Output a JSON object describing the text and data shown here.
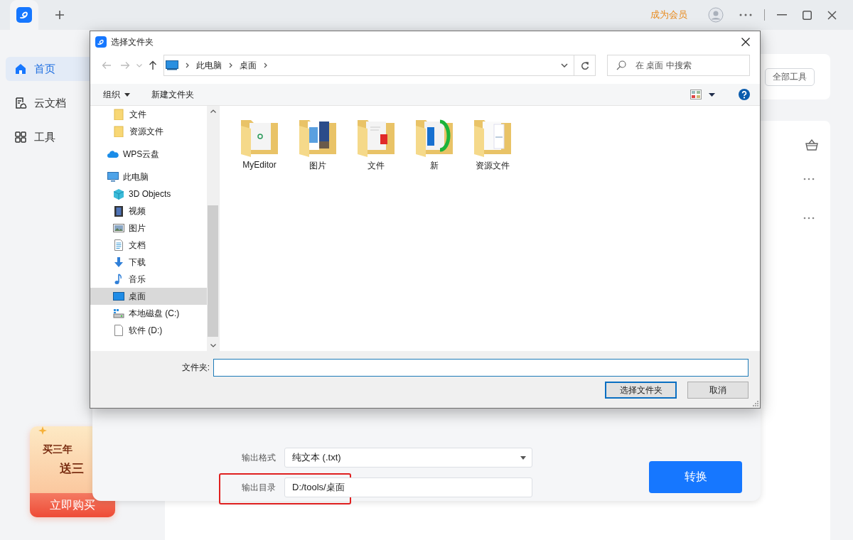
{
  "app": {
    "member_link": "成为会员",
    "sidebar": [
      {
        "label": "首页",
        "kind": "home",
        "selected": true
      },
      {
        "label": "云文档",
        "kind": "cloud-doc",
        "selected": false
      },
      {
        "label": "工具",
        "kind": "tools",
        "selected": false
      }
    ],
    "promo": {
      "line_1": "买三年",
      "line_2": "送三",
      "button": "立即购买"
    },
    "all_tools_button": "全部工具"
  },
  "convert_panel": {
    "rows": [
      {
        "label": "输出格式",
        "value": "纯文本 (.txt)",
        "kind": "select",
        "highlighted": false
      },
      {
        "label": "输出目录",
        "value": "D:/tools/桌面",
        "kind": "path",
        "highlighted": true
      }
    ],
    "convert_button": "转换"
  },
  "dialog": {
    "title": "选择文件夹",
    "breadcrumb": [
      "此电脑",
      "桌面"
    ],
    "search": {
      "placeholder": "在 桌面 中搜索"
    },
    "toolbar": [
      "组织",
      "新建文件夹"
    ],
    "nav": [
      {
        "label": "文件",
        "kind": "folder",
        "selected": false
      },
      {
        "label": "资源文件",
        "kind": "folder",
        "selected": false
      },
      {
        "label": "WPS云盘",
        "kind": "cloud",
        "selected": false
      },
      {
        "label": "此电脑",
        "kind": "pc",
        "selected": false,
        "children": [
          {
            "label": "3D Objects",
            "kind": "cube",
            "selected": false
          },
          {
            "label": "视频",
            "kind": "film",
            "selected": false
          },
          {
            "label": "图片",
            "kind": "picture",
            "selected": false
          },
          {
            "label": "文档",
            "kind": "document",
            "selected": false
          },
          {
            "label": "下载",
            "kind": "download",
            "selected": false
          },
          {
            "label": "音乐",
            "kind": "music",
            "selected": false
          },
          {
            "label": "桌面",
            "kind": "desktop",
            "selected": true
          },
          {
            "label": "本地磁盘 (C:)",
            "kind": "drive",
            "selected": false
          },
          {
            "label": "软件 (D:)",
            "kind": "disk",
            "selected": false
          }
        ]
      }
    ],
    "files": [
      {
        "name": "MyEditor",
        "kind": "app"
      },
      {
        "name": "图片",
        "kind": "pictures"
      },
      {
        "name": "文件",
        "kind": "documents"
      },
      {
        "name": "新",
        "kind": "screenshot"
      },
      {
        "name": "资源文件",
        "kind": "pages"
      }
    ],
    "folder_label": "文件夹:",
    "buttons": [
      {
        "label": "选择文件夹",
        "default": true
      },
      {
        "label": "取消",
        "default": false
      }
    ]
  }
}
